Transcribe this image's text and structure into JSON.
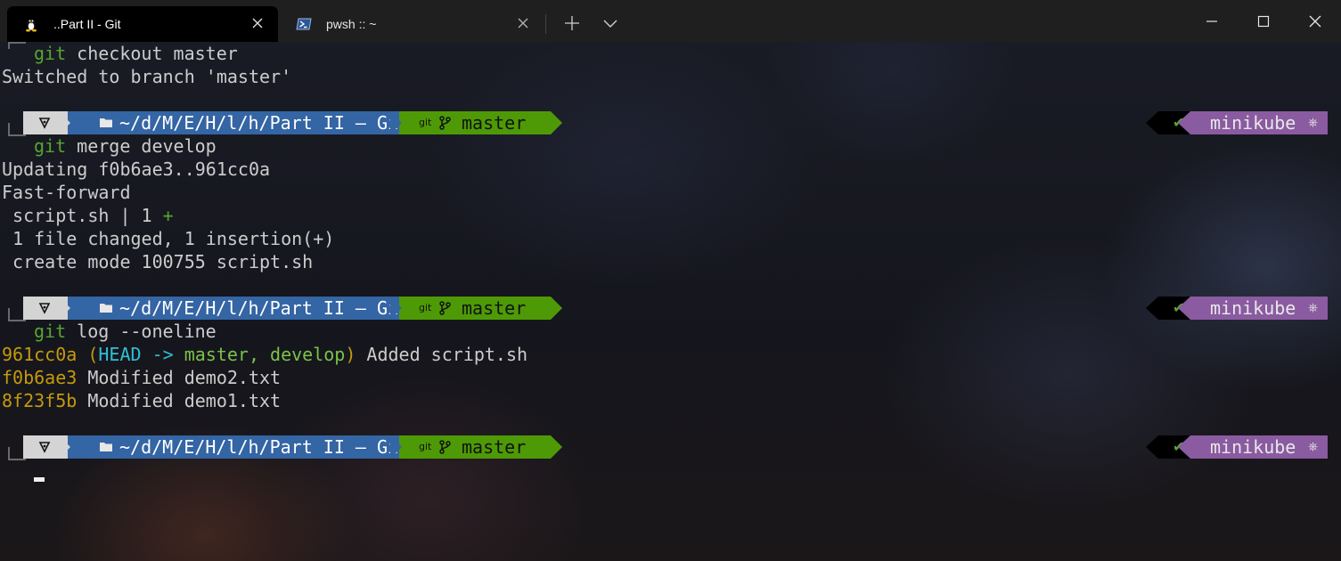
{
  "tabs": [
    {
      "label": "..Part II - Git",
      "icon": "linux-icon",
      "active": true
    },
    {
      "label": "pwsh :: ~",
      "icon": "powershell-icon",
      "active": false
    }
  ],
  "terminal": {
    "cmd_checkout": {
      "git": "git",
      "rest": " checkout master"
    },
    "out_switched": "Switched to branch 'master'",
    "prompt": {
      "path": "~/d/M/E/H/l/h/Part II – Git",
      "git_label": "git",
      "branch": "master",
      "status": "✔",
      "kube": "minikube",
      "kube_icon": "⎈"
    },
    "cmd_merge": {
      "git": "git",
      "rest": " merge develop"
    },
    "out_merge": [
      "Updating f0b6ae3..961cc0a",
      "Fast-forward",
      " script.sh | 1 ",
      "+",
      " 1 file changed, 1 insertion(+)",
      " create mode 100755 script.sh"
    ],
    "cmd_log": {
      "git": "git",
      "rest": " log --oneline"
    },
    "log": [
      {
        "hash": "961cc0a",
        "open": " (",
        "head": "HEAD -> ",
        "refs": "master, develop",
        "close": ")",
        "msg": " Added script.sh"
      },
      {
        "hash": "f0b6ae3",
        "msg": " Modified demo2.txt"
      },
      {
        "hash": "8f23f5b",
        "msg": " Modified demo1.txt"
      }
    ]
  }
}
